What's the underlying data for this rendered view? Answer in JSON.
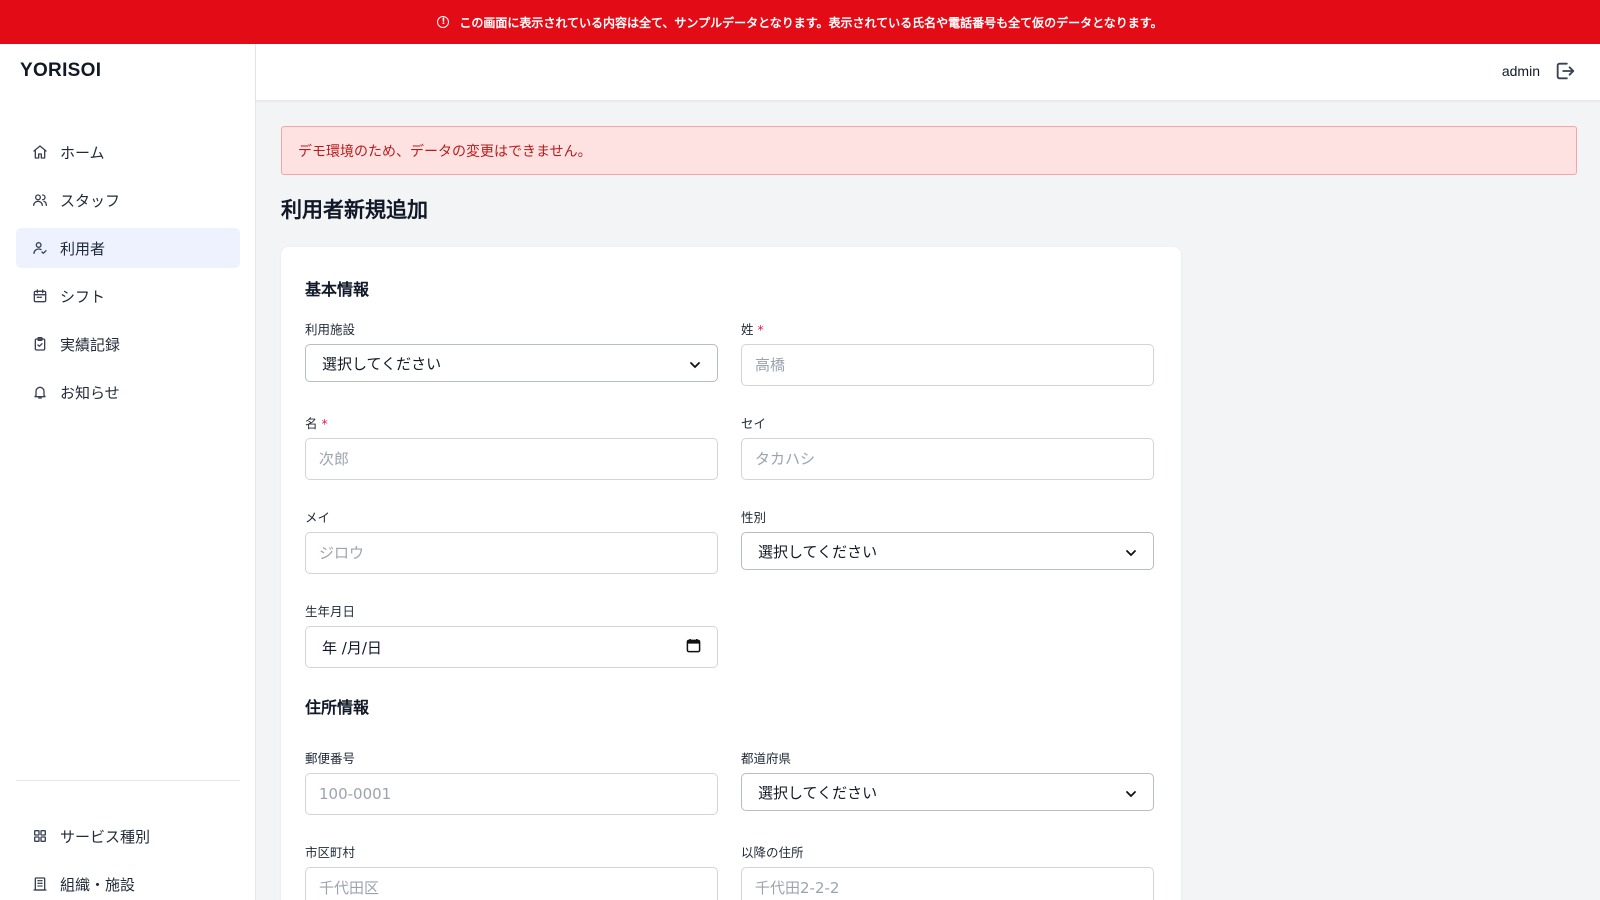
{
  "banner": {
    "text": "この画面に表示されている内容は全て、サンプルデータとなります。表示されている氏名や電話番号も全て仮のデータとなります。"
  },
  "app": {
    "logo": "YORISOI"
  },
  "sidebar": {
    "items": [
      {
        "label": "ホーム",
        "icon": "home-icon"
      },
      {
        "label": "スタッフ",
        "icon": "users-icon"
      },
      {
        "label": "利用者",
        "icon": "user-check-icon",
        "active": true
      },
      {
        "label": "シフト",
        "icon": "calendar-icon"
      },
      {
        "label": "実績記録",
        "icon": "clipboard-icon"
      },
      {
        "label": "お知らせ",
        "icon": "bell-icon"
      }
    ],
    "bottom_items": [
      {
        "label": "サービス種別",
        "icon": "grid-icon"
      },
      {
        "label": "組織・施設",
        "icon": "building-icon"
      }
    ]
  },
  "header": {
    "user": "admin",
    "logout_icon": "logout-icon"
  },
  "alert": {
    "text": "デモ環境のため、データの変更はできません。"
  },
  "page": {
    "title": "利用者新規追加"
  },
  "form": {
    "basic_section": "基本情報",
    "address_section": "住所情報",
    "facility": {
      "label": "利用施設",
      "value": "選択してください"
    },
    "last_name": {
      "label": "姓",
      "placeholder": "高橋",
      "required": true
    },
    "first_name": {
      "label": "名",
      "placeholder": "次郎",
      "required": true
    },
    "last_kana": {
      "label": "セイ",
      "placeholder": "タカハシ"
    },
    "first_kana": {
      "label": "メイ",
      "placeholder": "ジロウ"
    },
    "gender": {
      "label": "性別",
      "value": "選択してください"
    },
    "birthdate": {
      "label": "生年月日",
      "value": "年 /月/日"
    },
    "postal": {
      "label": "郵便番号",
      "placeholder": "100-0001"
    },
    "prefecture": {
      "label": "都道府県",
      "value": "選択してください"
    },
    "city": {
      "label": "市区町村",
      "placeholder": "千代田区"
    },
    "address": {
      "label": "以降の住所",
      "placeholder": "千代田2-2-2"
    }
  },
  "colors": {
    "banner": "#e20b16",
    "alert_bg": "#fee2e2",
    "alert_text": "#b91c1c",
    "active_nav": "#eef2ff",
    "required": "#e11d48"
  }
}
